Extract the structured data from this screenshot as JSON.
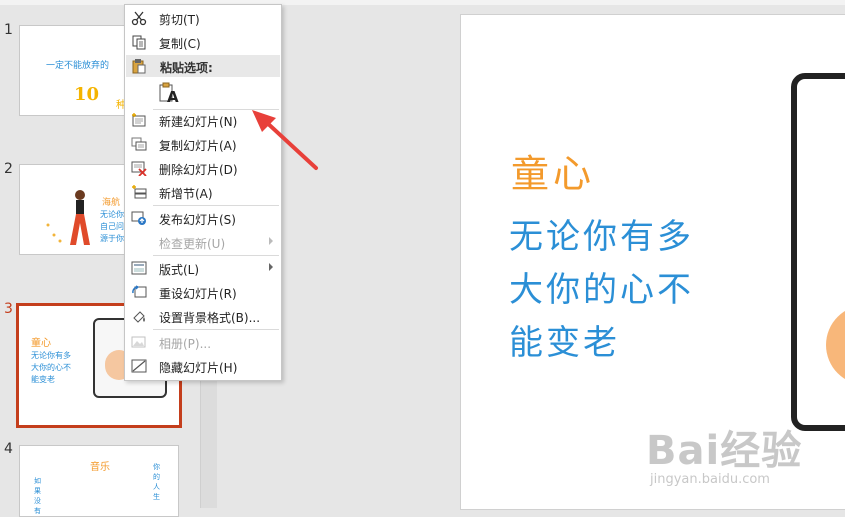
{
  "slides": [
    {
      "number": "1",
      "line1": "一定不能放弃的",
      "line2": "10",
      "line3": "种多"
    },
    {
      "number": "2",
      "line1": "海航",
      "line2": "无论你",
      "line3": "自己问",
      "line4": "源于你"
    },
    {
      "number": "3",
      "title": "童心",
      "line1": "无论你有多",
      "line2": "大你的心不",
      "line3": "能变老"
    },
    {
      "number": "4",
      "title": "音乐",
      "line1": "你的人生",
      "line2": "如果没有"
    }
  ],
  "main_slide": {
    "title": "童心",
    "lines": [
      "无论你有多",
      "大你的心不",
      "能变老"
    ]
  },
  "context_menu": {
    "items": [
      {
        "label": "剪切(T)",
        "icon": "scissors-icon"
      },
      {
        "label": "复制(C)",
        "icon": "copy-icon"
      },
      {
        "label": "粘贴选项:",
        "icon": "paste-icon"
      },
      {
        "label": "新建幻灯片(N)",
        "icon": "new-slide-icon"
      },
      {
        "label": "复制幻灯片(A)",
        "icon": "duplicate-slide-icon"
      },
      {
        "label": "删除幻灯片(D)",
        "icon": "delete-slide-icon"
      },
      {
        "label": "新增节(A)",
        "icon": "add-section-icon"
      },
      {
        "label": "发布幻灯片(S)",
        "icon": "publish-slides-icon"
      },
      {
        "label": "检查更新(U)",
        "icon": "check-updates-icon",
        "disabled": true
      },
      {
        "label": "版式(L)",
        "icon": "layout-icon"
      },
      {
        "label": "重设幻灯片(R)",
        "icon": "reset-slide-icon"
      },
      {
        "label": "设置背景格式(B)...",
        "icon": "format-background-icon"
      },
      {
        "label": "相册(P)...",
        "icon": "photo-album-icon",
        "disabled": true
      },
      {
        "label": "隐藏幻灯片(H)",
        "icon": "hide-slide-icon"
      }
    ],
    "paste_option_glyph": "A"
  },
  "watermark": {
    "main": "Bai经验",
    "sub": "jingyan.baidu.com"
  },
  "colors": {
    "accent_selection": "#c43e1c",
    "title_orange": "#f39a2c",
    "body_blue": "#2b8fd6",
    "annotation_arrow": "#e8403a"
  }
}
